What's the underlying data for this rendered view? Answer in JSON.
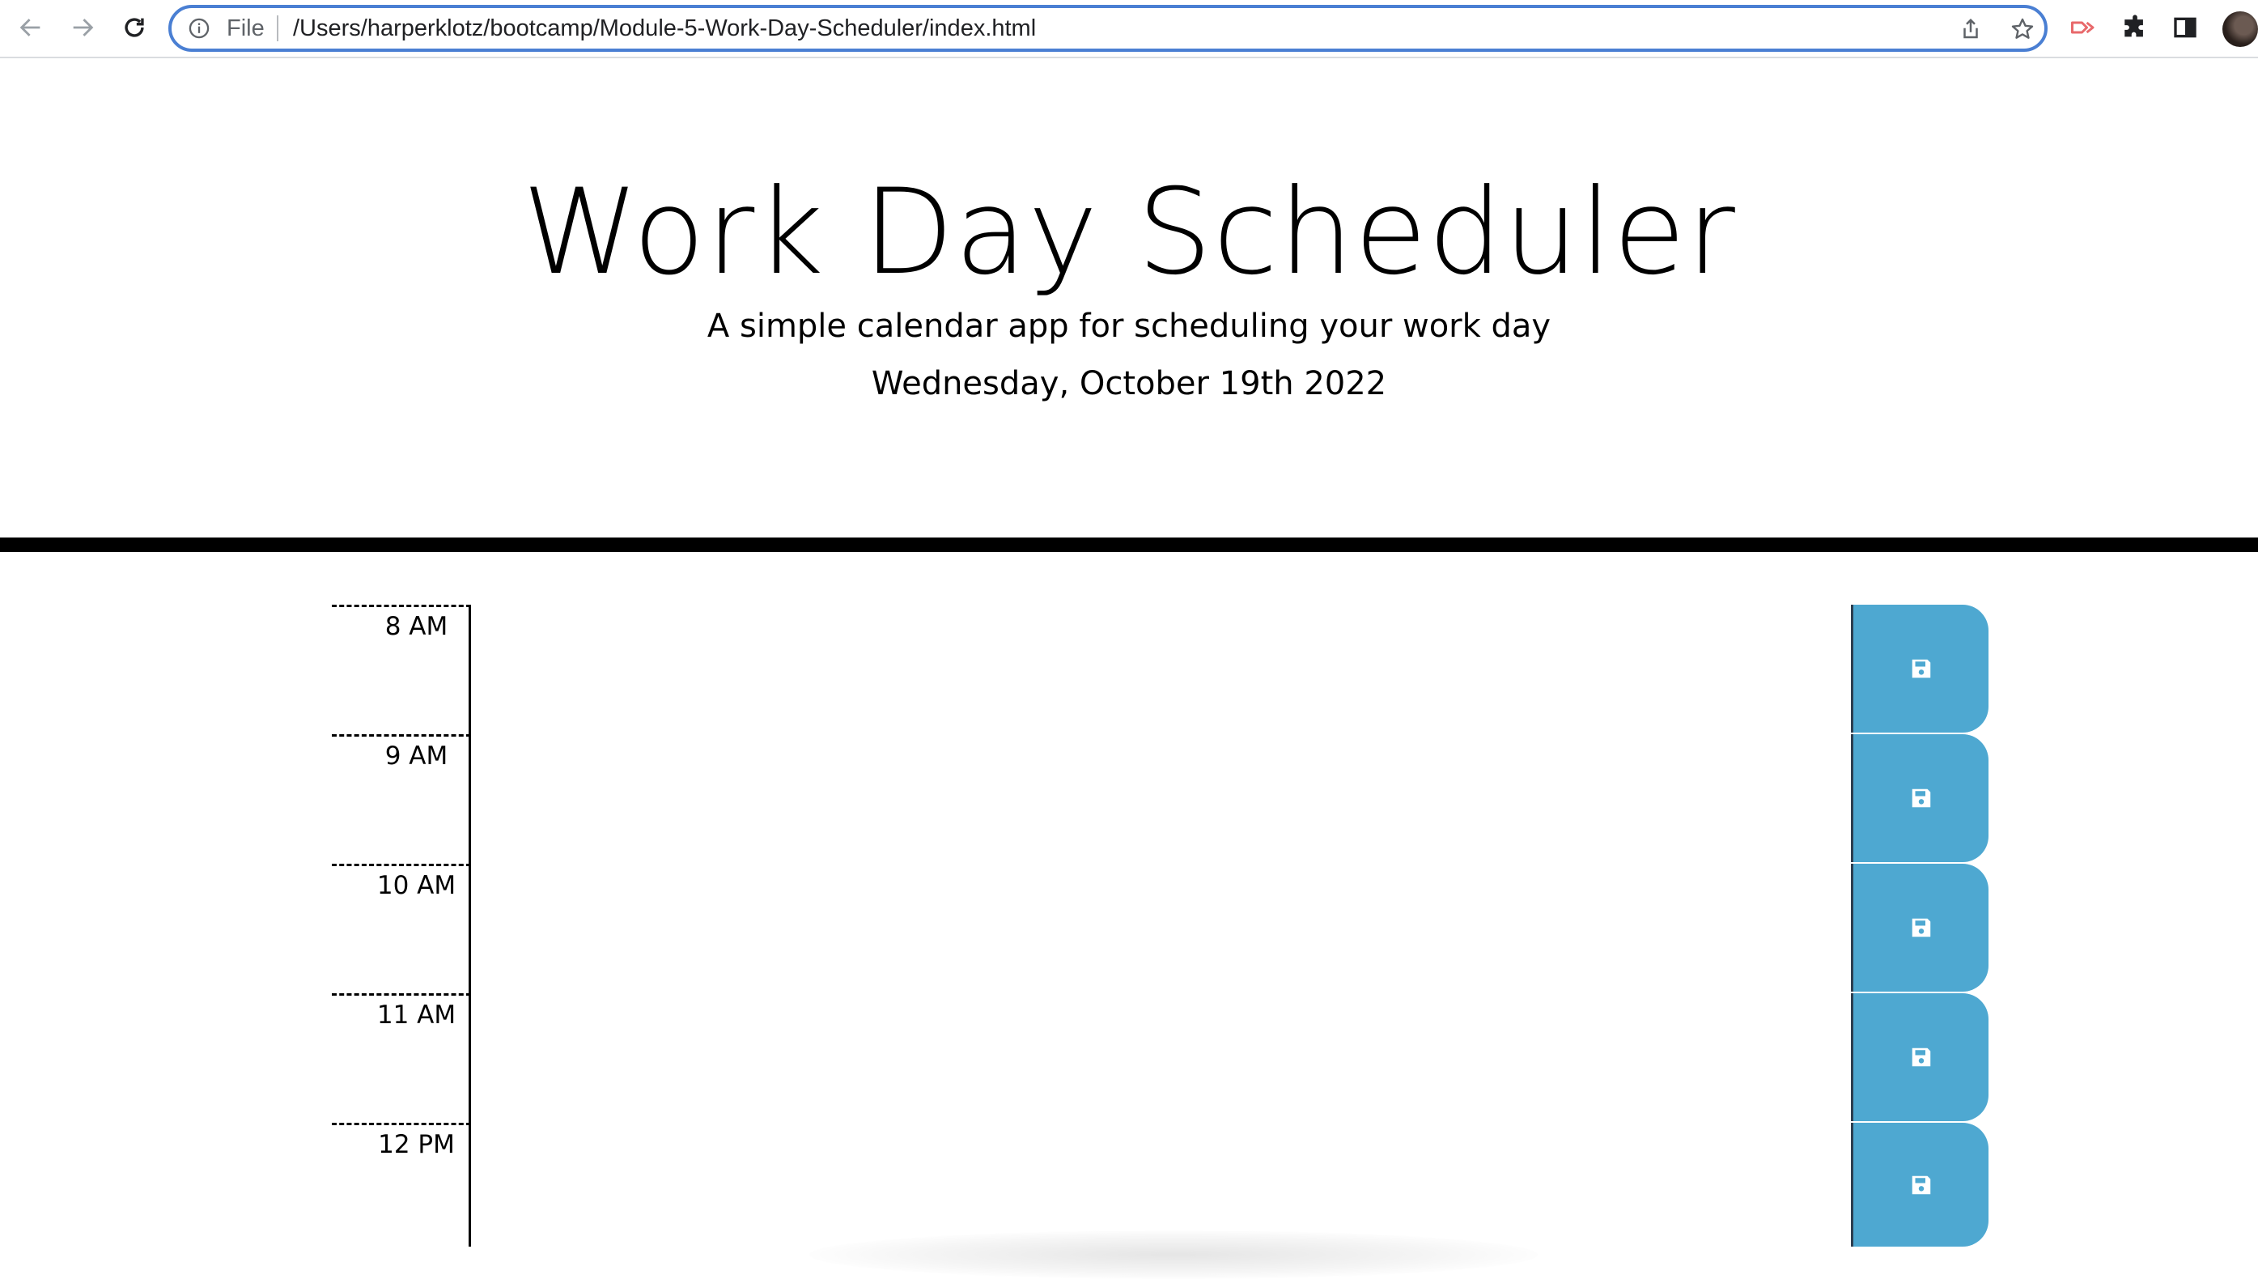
{
  "browser": {
    "omnibox": {
      "scheme_label": "File",
      "url": "/Users/harperklotz/bootcamp/Module-5-Work-Day-Scheduler/index.html"
    },
    "icons": {
      "back": "arrow-left-icon",
      "forward": "arrow-right-icon",
      "reload": "reload-icon",
      "info": "info-icon",
      "share": "share-icon",
      "bookmark": "star-icon",
      "extension_red": "extension-arrow-icon",
      "extensions": "puzzle-icon",
      "side_panel": "side-panel-icon",
      "profile": "avatar"
    },
    "accent": "#4a7fd3"
  },
  "header": {
    "title": "Work Day Scheduler",
    "lead": "A simple calendar app for scheduling your work day",
    "current_day": "Wednesday, October 19th 2022"
  },
  "schedule": {
    "save_icon": "floppy-disk-icon",
    "save_color": "#4ea8d1",
    "blocks": [
      {
        "hour": "8 AM",
        "description": ""
      },
      {
        "hour": "9 AM",
        "description": ""
      },
      {
        "hour": "10 AM",
        "description": ""
      },
      {
        "hour": "11 AM",
        "description": ""
      },
      {
        "hour": "12 PM",
        "description": ""
      }
    ]
  }
}
